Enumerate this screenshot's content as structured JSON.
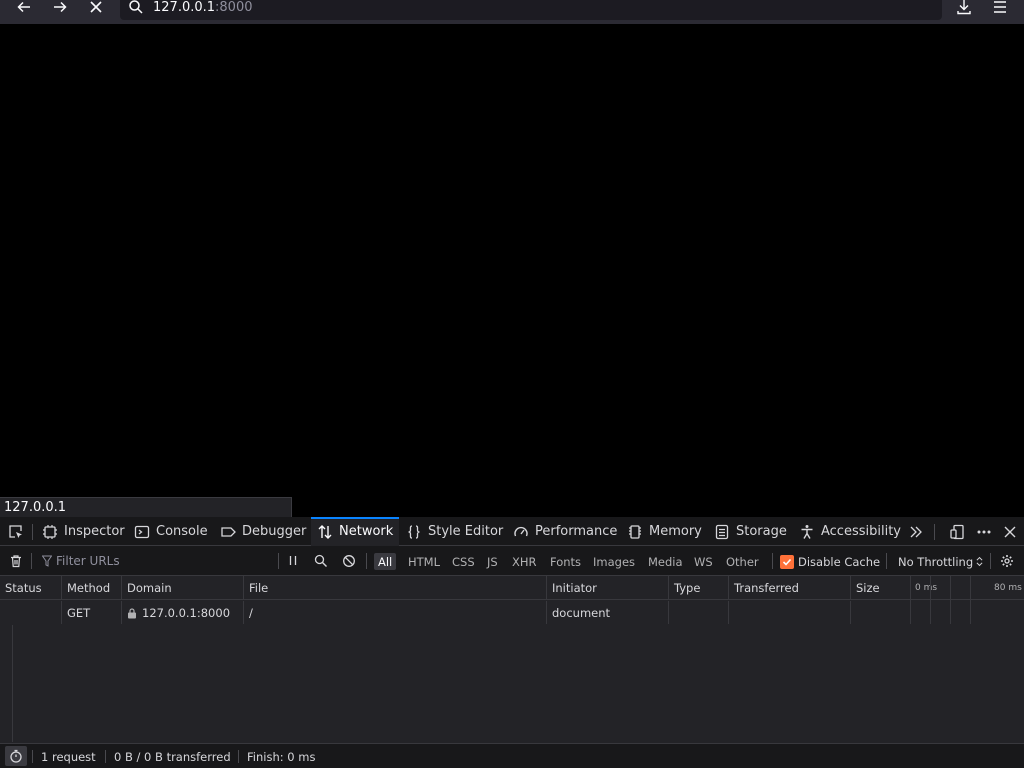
{
  "browser": {
    "url_host": "127.0.0.1",
    "url_port": ":8000",
    "back_icon": "arrow-left-icon",
    "forward_icon": "arrow-right-icon",
    "stop_icon": "close-icon",
    "search_icon": "search-icon",
    "downloads_icon": "download-icon",
    "menu_icon": "hamburger-menu-icon"
  },
  "status_panel": {
    "text": "127.0.0.1"
  },
  "devtools": {
    "tabs": [
      {
        "label": "Inspector",
        "icon": "inspector-icon",
        "selected": false
      },
      {
        "label": "Console",
        "icon": "console-icon",
        "selected": false
      },
      {
        "label": "Debugger",
        "icon": "debugger-icon",
        "selected": false
      },
      {
        "label": "Network",
        "icon": "network-icon",
        "selected": true
      },
      {
        "label": "Style Editor",
        "icon": "braces-icon",
        "selected": false
      },
      {
        "label": "Performance",
        "icon": "gauge-icon",
        "selected": false
      },
      {
        "label": "Memory",
        "icon": "chip-icon",
        "selected": false
      },
      {
        "label": "Storage",
        "icon": "storage-icon",
        "selected": false
      },
      {
        "label": "Accessibility",
        "icon": "accessibility-icon",
        "selected": false
      }
    ],
    "accent": "#0a84ff"
  },
  "network": {
    "filter_placeholder": "Filter URLs",
    "types": [
      "All",
      "HTML",
      "CSS",
      "JS",
      "XHR",
      "Fonts",
      "Images",
      "Media",
      "WS",
      "Other"
    ],
    "active_type": "All",
    "disable_cache_label": "Disable Cache",
    "disable_cache_checked": true,
    "throttle_label": "No Throttling",
    "columns": [
      "Status",
      "Method",
      "Domain",
      "File",
      "Initiator",
      "Type",
      "Transferred",
      "Size"
    ],
    "waterfall_ticks": [
      "0 ms",
      "80 ms"
    ],
    "rows": [
      {
        "status": "",
        "method": "GET",
        "domain": "127.0.0.1:8000",
        "file": "/",
        "initiator": "document",
        "type": "",
        "transferred": "",
        "size": ""
      }
    ],
    "footer": {
      "requests": "1 request",
      "transferred": "0 B / 0 B transferred",
      "finish": "Finish: 0 ms"
    }
  }
}
